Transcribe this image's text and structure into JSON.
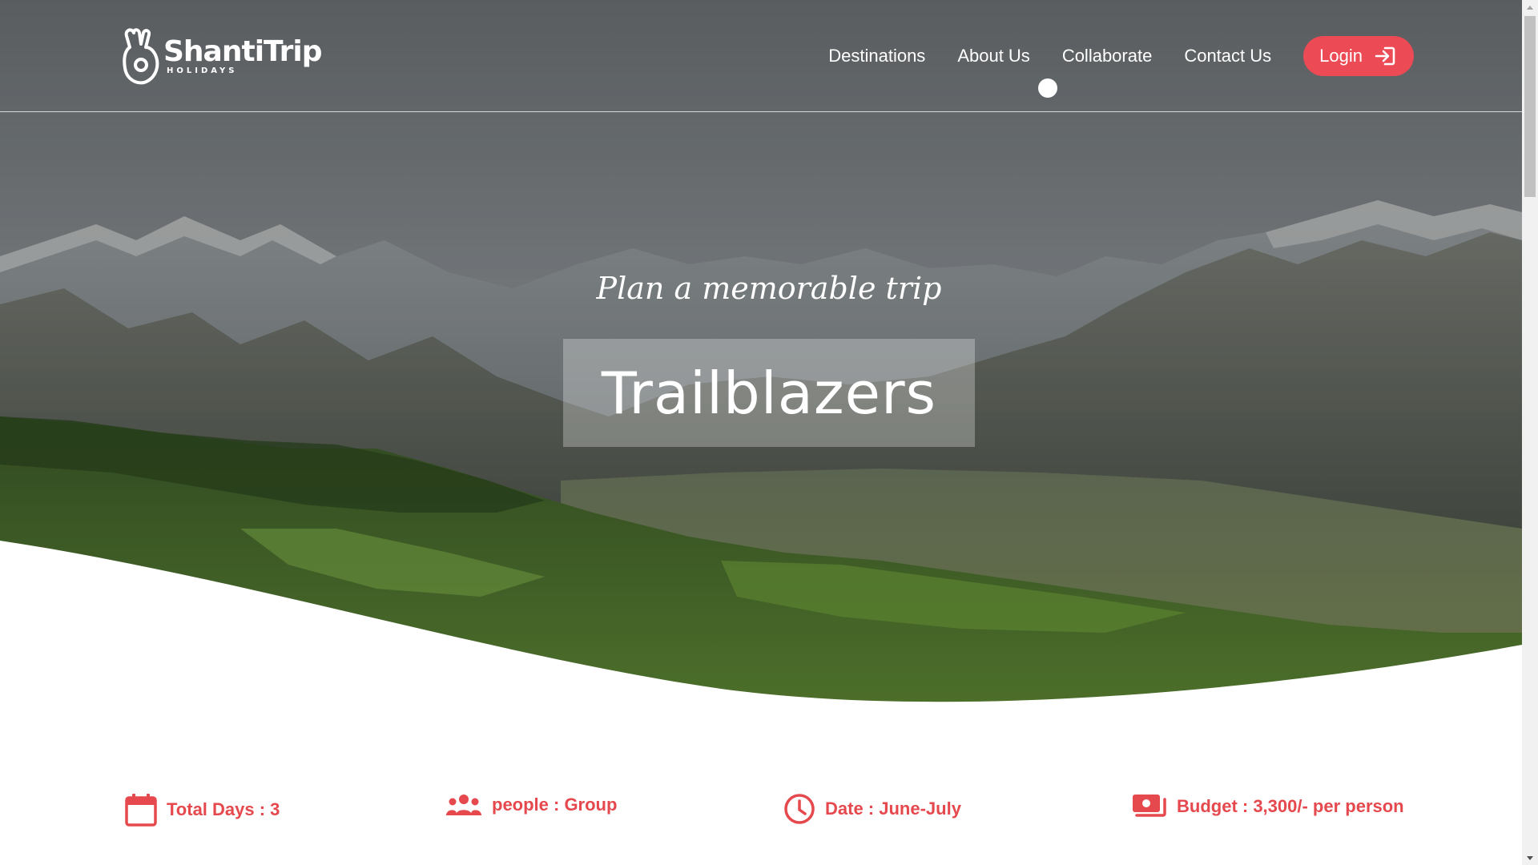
{
  "brand": {
    "name": "ShantiTrip",
    "subtitle": "HOLIDAYS"
  },
  "nav": {
    "items": [
      {
        "label": "Destinations"
      },
      {
        "label": "About Us"
      },
      {
        "label": "Collaborate"
      },
      {
        "label": "Contact Us"
      }
    ],
    "login_label": "Login"
  },
  "hero": {
    "tagline": "Plan a memorable trip",
    "title": "Trailblazers"
  },
  "trip_info": {
    "total_days": "Total Days : 3",
    "people": "people : Group",
    "date": "Date : June-July",
    "budget": "Budget : 3,300/- per person"
  },
  "icons": {
    "days": "calendar-icon",
    "people": "group-icon",
    "date": "clock-icon",
    "budget": "money-icon",
    "login": "login-arrow-icon"
  },
  "colors": {
    "accent": "#ec4a55",
    "info_text": "#e5484d"
  }
}
